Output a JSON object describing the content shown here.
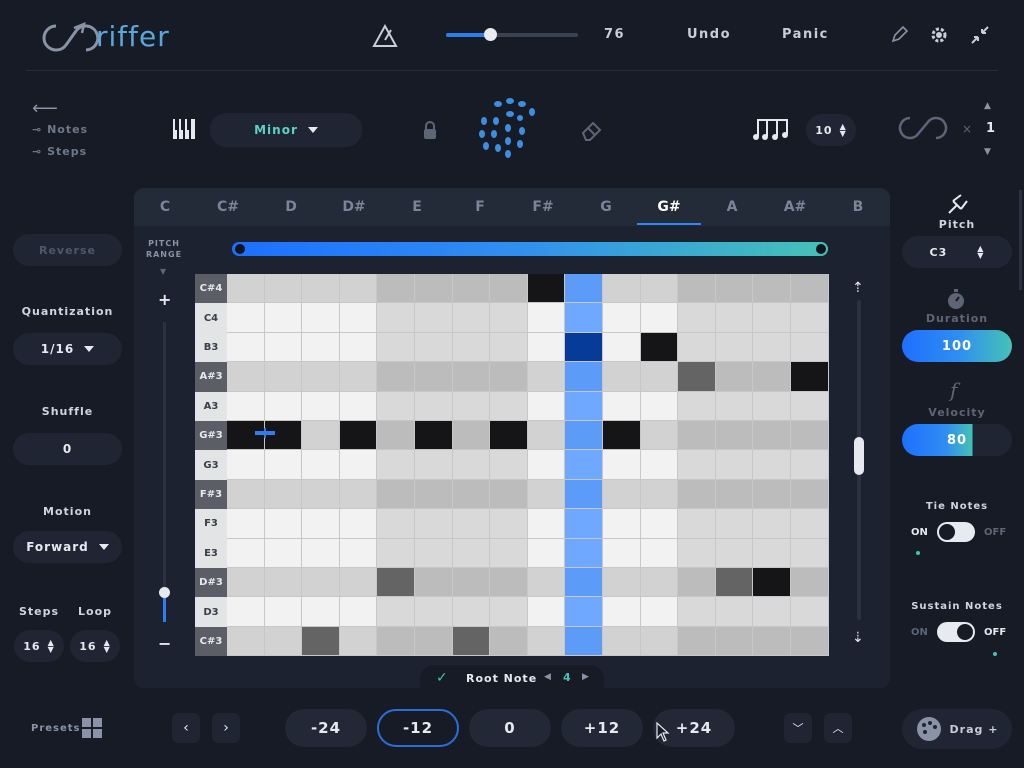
{
  "app": {
    "logo": "riffer"
  },
  "header": {
    "tempo_value": "76",
    "undo_label": "Undo",
    "panic_label": "Panic"
  },
  "toolbar": {
    "back_icon": "arrow-left-icon",
    "notes_label": "Notes",
    "steps_label": "Steps",
    "scale": "Minor",
    "steps_count": "10",
    "loop_multiplier_x": "×",
    "loop_multiplier": "1"
  },
  "keys": [
    "C",
    "C#",
    "D",
    "D#",
    "E",
    "F",
    "F#",
    "G",
    "G#",
    "A",
    "A#",
    "B"
  ],
  "active_key": "G#",
  "pitch_range_label": "PITCH\nRANGE",
  "pitch_range_line1": "PITCH",
  "pitch_range_line2": "RANGE",
  "grid": {
    "rows": [
      "C#4",
      "C4",
      "B3",
      "A#3",
      "A3",
      "G#3",
      "G3",
      "F#3",
      "F3",
      "E3",
      "D#3",
      "D3",
      "C#3"
    ],
    "shaded_rows": [
      "C#4",
      "A#3",
      "G#3",
      "F#3",
      "D#3",
      "C#3"
    ],
    "columns": 16,
    "playhead_column": 10,
    "notes": [
      {
        "row": "C#4",
        "col": 9
      },
      {
        "row": "B3",
        "col": 10
      },
      {
        "row": "B3",
        "col": 12
      },
      {
        "row": "A#3",
        "col": 13
      },
      {
        "row": "A#3",
        "col": 16
      },
      {
        "row": "G#3",
        "col": 1
      },
      {
        "row": "G#3",
        "col": 2
      },
      {
        "row": "G#3",
        "col": 4
      },
      {
        "row": "G#3",
        "col": 6
      },
      {
        "row": "G#3",
        "col": 8
      },
      {
        "row": "G#3",
        "col": 11
      },
      {
        "row": "D#3",
        "col": 5
      },
      {
        "row": "D#3",
        "col": 14
      },
      {
        "row": "D#3",
        "col": 15
      },
      {
        "row": "C#3",
        "col": 3
      },
      {
        "row": "C#3",
        "col": 7
      }
    ]
  },
  "left": {
    "reverse_label": "Reverse",
    "quantization_label": "Quantization",
    "quantization_value": "1/16",
    "shuffle_label": "Shuffle",
    "shuffle_value": "0",
    "motion_label": "Motion",
    "motion_value": "Forward",
    "steps_label": "Steps",
    "steps_value": "16",
    "loop_label": "Loop",
    "loop_value": "16"
  },
  "right": {
    "pitch_label": "Pitch",
    "pitch_value": "C3",
    "duration_label": "Duration",
    "duration_value": "100",
    "duration_level": 100,
    "velocity_label": "Velocity",
    "velocity_value": "80",
    "velocity_level": 80,
    "tie_notes_label": "Tie Notes",
    "tie_on": "ON",
    "tie_off": "OFF",
    "sustain_notes_label": "Sustain Notes",
    "sustain_on": "ON",
    "sustain_off": "OFF"
  },
  "root_note": {
    "label": "Root Note",
    "value": "4"
  },
  "bottom": {
    "presets_label": "Presets",
    "transpose": [
      "-24",
      "-12",
      "0",
      "+12",
      "+24"
    ],
    "selected_transpose": "-12",
    "drag_label": "Drag +"
  },
  "colors": {
    "accent": "#2e7df0",
    "teal": "#45c2b6",
    "playhead": "#6aa6ff"
  }
}
